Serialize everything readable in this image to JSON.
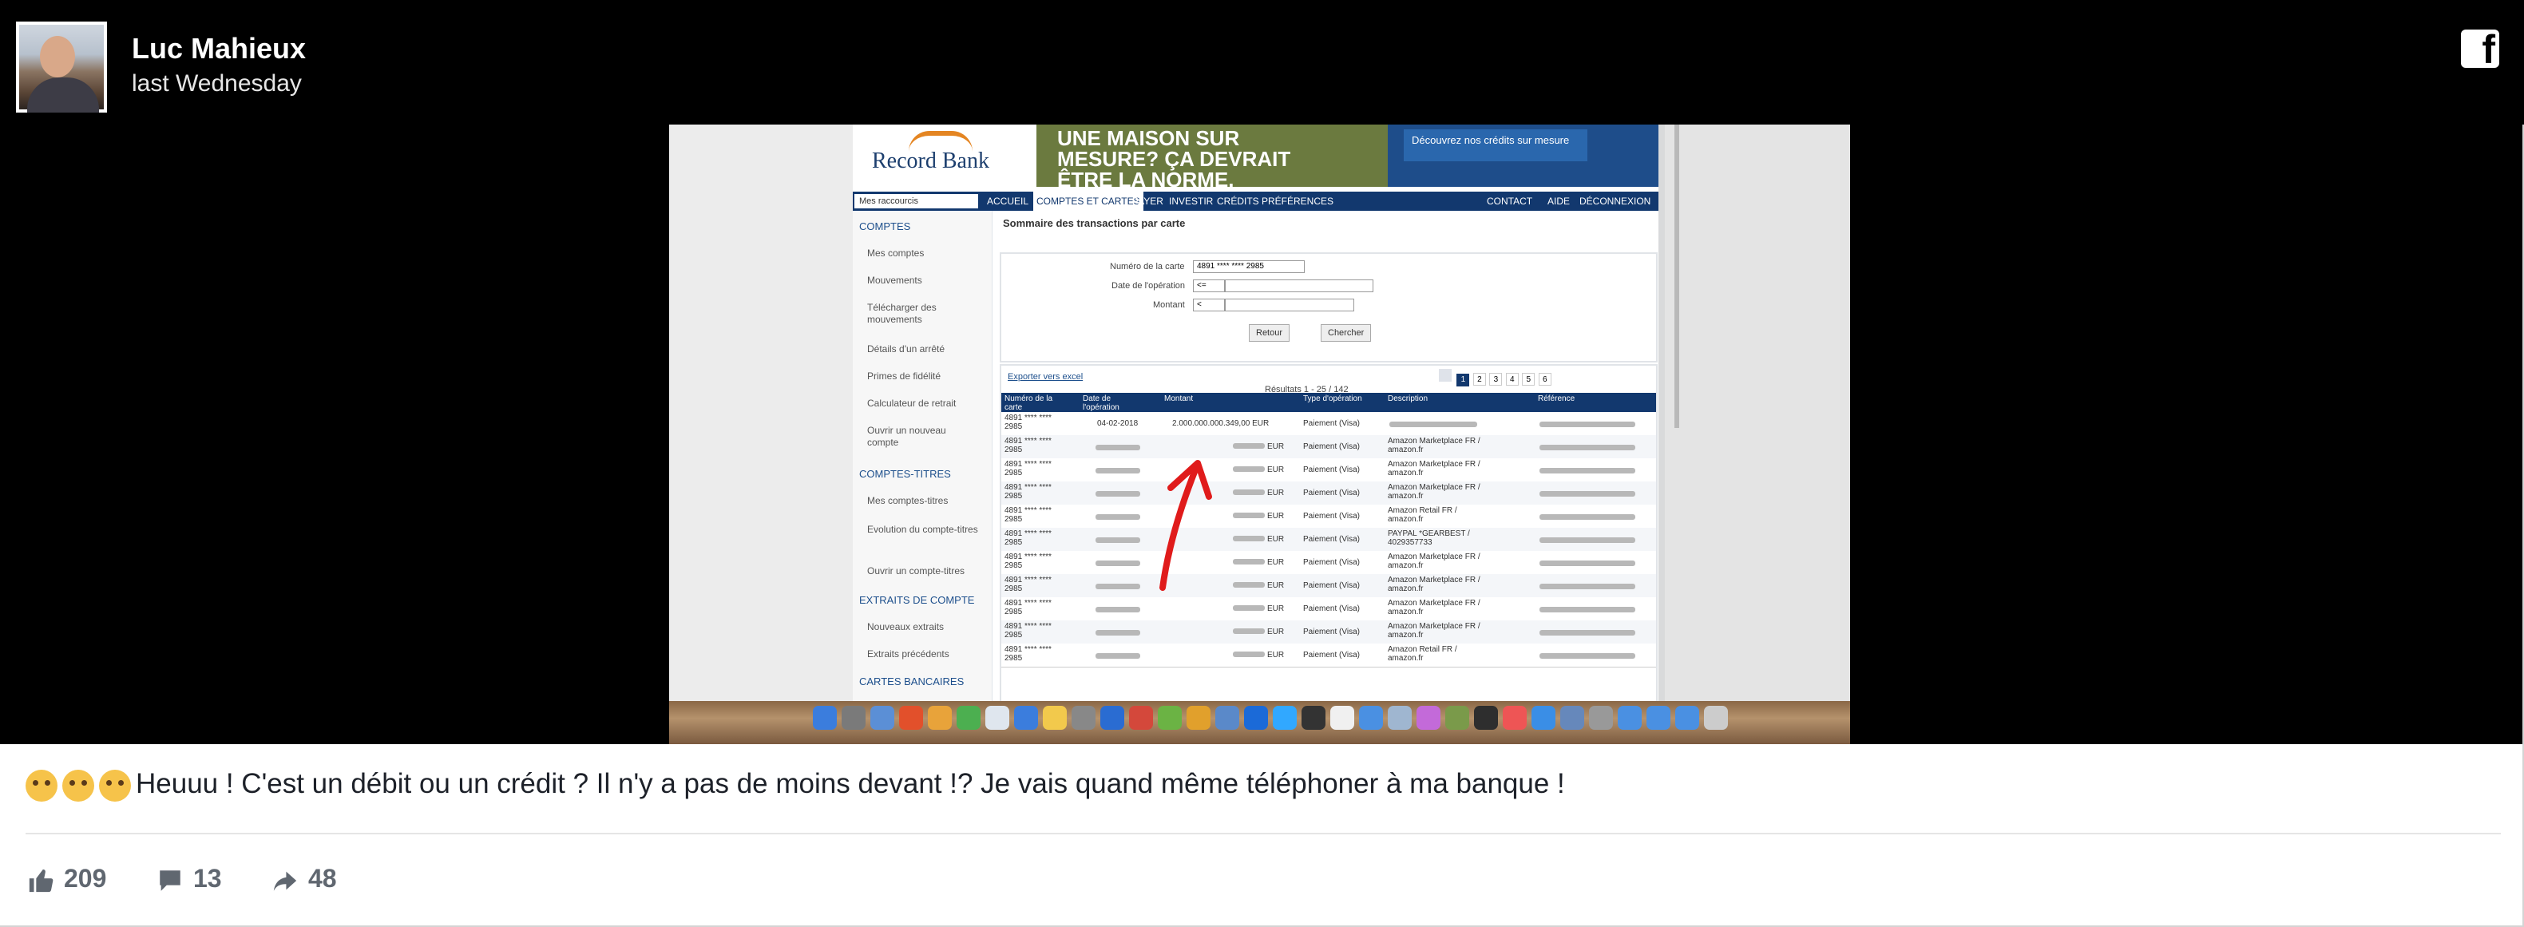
{
  "post": {
    "author": "Luc Mahieux",
    "time": "last Wednesday",
    "message": "Heuuu ! C'est un débit ou un crédit ? Il n'y a pas de moins devant !? Je vais quand même téléphoner à ma banque !",
    "emojis": [
      "thinking-face",
      "worried-face",
      "flushed-face"
    ],
    "stats": {
      "likes": "209",
      "comments": "13",
      "shares": "48"
    }
  },
  "screenshot": {
    "bank_logo": "Record Bank",
    "ad_text": [
      "UNE MAISON SUR",
      "MESURE? ÇA DEVRAIT",
      "ÊTRE LA NORME."
    ],
    "ad_button": "Découvrez nos crédits sur mesure",
    "dropdown": "Mes raccourcis",
    "nav": [
      "ACCUEIL",
      "COMPTES ET CARTES",
      "PAYER",
      "INVESTIR",
      "CRÉDITS",
      "PRÉFÉRENCES"
    ],
    "nav_right": [
      "CONTACT",
      "AIDE",
      "DÉCONNEXION"
    ],
    "sidebar": [
      {
        "label": "COMPTES",
        "section": true
      },
      {
        "label": "Mes comptes"
      },
      {
        "label": "Mouvements"
      },
      {
        "label": "Télécharger des mouvements"
      },
      {
        "label": "Détails d'un arrêté"
      },
      {
        "label": "Primes de fidélité"
      },
      {
        "label": "Calculateur de retrait"
      },
      {
        "label": "Ouvrir un nouveau compte"
      },
      {
        "label": "COMPTES-TITRES",
        "section": true
      },
      {
        "label": "Mes comptes-titres"
      },
      {
        "label": "Evolution du compte-titres"
      },
      {
        "label": "Ouvrir un compte-titres"
      },
      {
        "label": "EXTRAITS DE COMPTE",
        "section": true
      },
      {
        "label": "Nouveaux extraits"
      },
      {
        "label": "Extraits précédents"
      },
      {
        "label": "CARTES BANCAIRES",
        "section": true
      }
    ],
    "summary_title": "Sommaire des transactions par carte",
    "form": {
      "card_label": "Numéro de la carte",
      "card_value": "4891 **** **** 2985",
      "date_label": "Date de l'opération",
      "date_value": "<=",
      "amount_label": "Montant",
      "amount_value": "<",
      "back": "Retour",
      "search": "Chercher"
    },
    "export": "Exporter vers excel",
    "results": "Résultats 1 - 25 / 142",
    "pages": [
      "1",
      "2",
      "3",
      "4",
      "5",
      "6"
    ],
    "columns": [
      "Numéro de la carte",
      "Date de l'opération",
      "Montant",
      "Type d'opération",
      "Description",
      "Référence"
    ],
    "rows": [
      {
        "card": "4891 **** **** 2985",
        "date": "04-02-2018",
        "amount": "2.000.000.000.349,00 EUR",
        "type": "Paiement (Visa)",
        "desc": ""
      },
      {
        "card": "4891 **** **** 2985",
        "date": "",
        "amount": "EUR",
        "type": "Paiement (Visa)",
        "desc": "Amazon Marketplace FR / amazon.fr"
      },
      {
        "card": "4891 **** **** 2985",
        "date": "",
        "amount": "EUR",
        "type": "Paiement (Visa)",
        "desc": "Amazon Marketplace FR / amazon.fr"
      },
      {
        "card": "4891 **** **** 2985",
        "date": "",
        "amount": "EUR",
        "type": "Paiement (Visa)",
        "desc": "Amazon Marketplace FR / amazon.fr"
      },
      {
        "card": "4891 **** **** 2985",
        "date": "",
        "amount": "EUR",
        "type": "Paiement (Visa)",
        "desc": "Amazon Retail FR / amazon.fr"
      },
      {
        "card": "4891 **** **** 2985",
        "date": "",
        "amount": "EUR",
        "type": "Paiement (Visa)",
        "desc": "PAYPAL *GEARBEST / 4029357733"
      },
      {
        "card": "4891 **** **** 2985",
        "date": "",
        "amount": "EUR",
        "type": "Paiement (Visa)",
        "desc": "Amazon Marketplace FR / amazon.fr"
      },
      {
        "card": "4891 **** **** 2985",
        "date": "",
        "amount": "EUR",
        "type": "Paiement (Visa)",
        "desc": "Amazon Marketplace FR / amazon.fr"
      },
      {
        "card": "4891 **** **** 2985",
        "date": "",
        "amount": "EUR",
        "type": "Paiement (Visa)",
        "desc": "Amazon Marketplace FR / amazon.fr"
      },
      {
        "card": "4891 **** **** 2985",
        "date": "",
        "amount": "EUR",
        "type": "Paiement (Visa)",
        "desc": "Amazon Marketplace FR / amazon.fr"
      },
      {
        "card": "4891 **** **** 2985",
        "date": "",
        "amount": "EUR",
        "type": "Paiement (Visa)",
        "desc": "Amazon Retail FR / amazon.fr"
      }
    ]
  },
  "colors": {
    "header_bg": "#000000",
    "bank_nav": "#12386e",
    "arrow": "#e01b1b",
    "stat_text": "#606770"
  }
}
